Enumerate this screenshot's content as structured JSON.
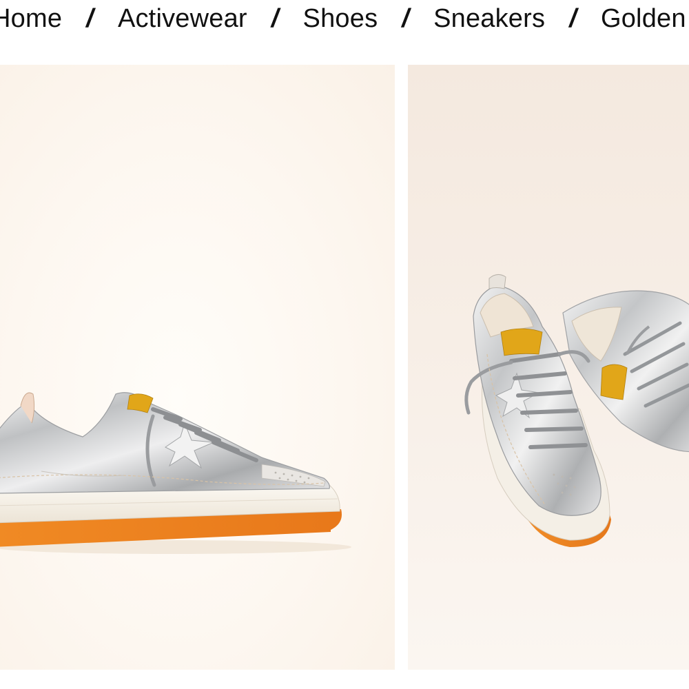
{
  "breadcrumb": {
    "items": [
      "Home",
      "Activewear",
      "Shoes",
      "Sneakers",
      "Golden"
    ],
    "separator": "/"
  },
  "gallery": {
    "images": [
      {
        "name": "product-image-side-view"
      },
      {
        "name": "product-image-pair-view"
      }
    ],
    "colors": {
      "background": "#fdf7f0",
      "silver": "#d9dadb",
      "sole": "#f4efe6",
      "outsole": "#ef8a22",
      "tab": "#e1a619"
    }
  }
}
